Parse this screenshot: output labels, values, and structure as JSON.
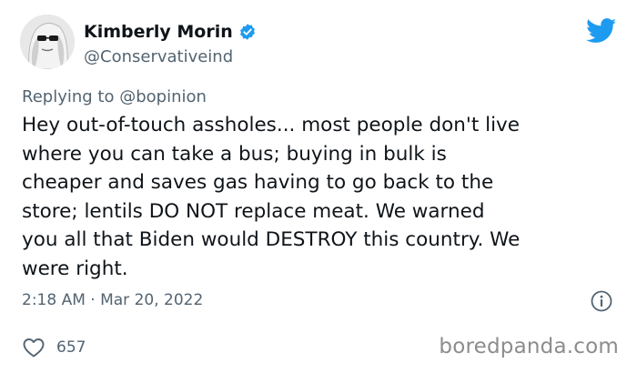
{
  "author": {
    "name": "Kimberly Morin",
    "handle": "@Conservativeind"
  },
  "reply": {
    "prefix": "Replying to ",
    "mention": "@bopinion"
  },
  "tweet": {
    "text": "Hey out-of-touch assholes... most people don't live\nwhere you can take a bus; buying in bulk is\ncheaper and saves gas having to go back to the\nstore; lentils DO NOT replace meat. We warned\nyou all that Biden would DESTROY this country. We\nwere right.",
    "timestamp": "2:18 AM · Mar 20, 2022"
  },
  "engagement": {
    "likes": "657"
  },
  "watermark": "boredpanda.com",
  "colors": {
    "verified": "#1d9bf0",
    "twitter_blue": "#1d9bf0",
    "text": "#0f1419",
    "secondary": "#536471"
  },
  "icons": {
    "verified": "verified-badge-icon",
    "brand": "twitter-bird-icon",
    "info": "info-icon",
    "like": "heart-icon"
  }
}
